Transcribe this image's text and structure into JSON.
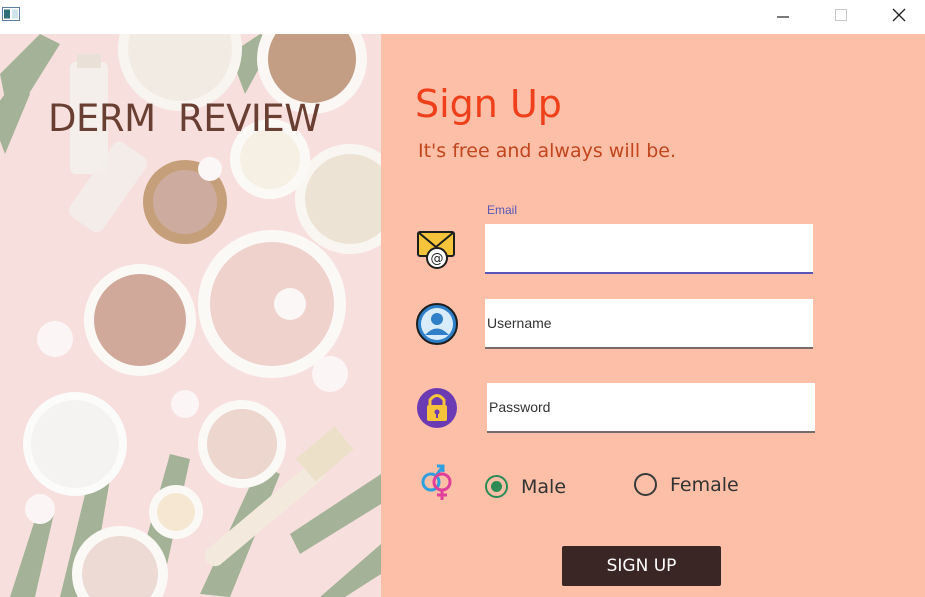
{
  "window": {
    "icon": "app-window-icon",
    "controls": {
      "minimize": "minimize-icon",
      "maximize": "maximize-icon",
      "close": "close-icon"
    }
  },
  "brand": {
    "text": "DERM  REVIEW"
  },
  "form": {
    "title": "Sign Up",
    "subtitle": "It's free and always will be.",
    "email": {
      "label": "Email",
      "value": "",
      "icon": "email-at-icon"
    },
    "username": {
      "placeholder": "Username",
      "icon": "user-avatar-icon"
    },
    "password": {
      "placeholder": "Password",
      "icon": "padlock-icon"
    },
    "gender": {
      "icon": "gender-symbol-icon",
      "options": [
        {
          "label": "Male",
          "selected": true
        },
        {
          "label": "Female",
          "selected": false
        }
      ]
    },
    "submit_label": "SIGN UP"
  },
  "colors": {
    "panel": "#fdbfa8",
    "title": "#f0401b",
    "subtitle": "#c2461f",
    "button": "#3b2626",
    "radio_selected": "#2e8b57",
    "brand": "#6a3f33",
    "focus": "#5a56b8"
  }
}
